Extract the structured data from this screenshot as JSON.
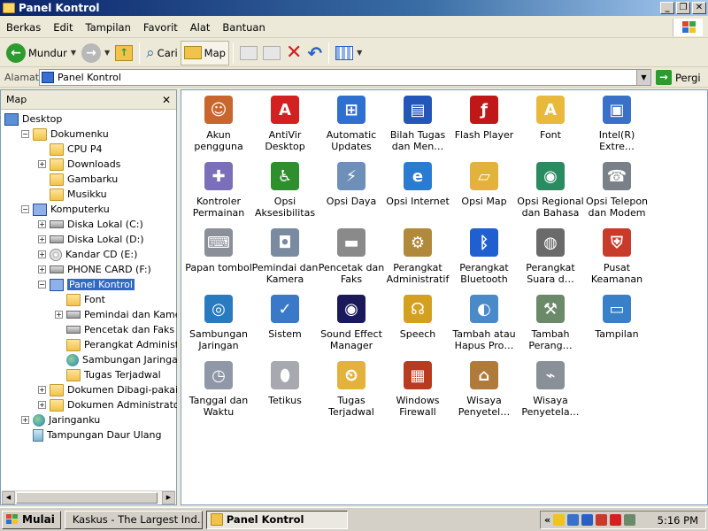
{
  "window": {
    "title": "Panel Kontrol"
  },
  "menu": [
    "Berkas",
    "Edit",
    "Tampilan",
    "Favorit",
    "Alat",
    "Bantuan"
  ],
  "toolbar": {
    "back_label": "Mundur",
    "search_label": "Cari",
    "folders_label": "Map"
  },
  "address": {
    "label": "Alamat",
    "value": "Panel Kontrol",
    "go_label": "Pergi"
  },
  "folders_pane": {
    "title": "Map",
    "tree": [
      {
        "label": "Desktop",
        "icon": "desktop-icon",
        "expander": ""
      },
      {
        "label": "Dokumenku",
        "icon": "folder-icon",
        "expander": "−"
      },
      {
        "label": "CPU P4",
        "icon": "folder-icon",
        "expander": ""
      },
      {
        "label": "Downloads",
        "icon": "folder-icon",
        "expander": "+"
      },
      {
        "label": "Gambarku",
        "icon": "folder-icon",
        "expander": ""
      },
      {
        "label": "Musikku",
        "icon": "folder-icon",
        "expander": ""
      },
      {
        "label": "Komputerku",
        "icon": "computer-icon",
        "expander": "−"
      },
      {
        "label": "Diska Lokal (C:)",
        "icon": "drive-icon",
        "expander": "+"
      },
      {
        "label": "Diska Lokal (D:)",
        "icon": "drive-icon",
        "expander": "+"
      },
      {
        "label": "Kandar CD (E:)",
        "icon": "cd-drive-icon",
        "expander": "+"
      },
      {
        "label": "PHONE CARD (F:)",
        "icon": "drive-icon",
        "expander": "+"
      },
      {
        "label": "Panel Kontrol",
        "icon": "control-panel-icon",
        "expander": "−",
        "selected": true
      },
      {
        "label": "Font",
        "icon": "folder-icon",
        "expander": ""
      },
      {
        "label": "Pemindai dan Kamera",
        "icon": "scanner-icon",
        "expander": "+"
      },
      {
        "label": "Pencetak dan Faks",
        "icon": "printer-icon",
        "expander": ""
      },
      {
        "label": "Perangkat Administratif",
        "icon": "admin-tools-icon",
        "expander": ""
      },
      {
        "label": "Sambungan Jaringan",
        "icon": "network-icon",
        "expander": ""
      },
      {
        "label": "Tugas Terjadwal",
        "icon": "folder-icon",
        "expander": ""
      },
      {
        "label": "Dokumen Dibagi-pakai",
        "icon": "folder-icon",
        "expander": "+"
      },
      {
        "label": "Dokumen Administrator",
        "icon": "folder-icon",
        "expander": "+"
      },
      {
        "label": "Jaringanku",
        "icon": "network-places-icon",
        "expander": "+"
      },
      {
        "label": "Tampungan Daur Ulang",
        "icon": "recycle-bin-icon",
        "expander": ""
      }
    ]
  },
  "items": [
    {
      "label": "Akun pengguna",
      "icon": "user-accounts-icon",
      "color": "#c9662e",
      "glyph": "☺"
    },
    {
      "label": "AntiVir Desktop",
      "icon": "antivir-icon",
      "color": "#d32020",
      "glyph": "A"
    },
    {
      "label": "Automatic Updates",
      "icon": "windows-update-icon",
      "color": "#2f6fd0",
      "glyph": "⊞"
    },
    {
      "label": "Bilah Tugas dan Men…",
      "icon": "taskbar-icon",
      "color": "#2356b8",
      "glyph": "▤"
    },
    {
      "label": "Flash Player",
      "icon": "flash-player-icon",
      "color": "#c01818",
      "glyph": "ƒ"
    },
    {
      "label": "Font",
      "icon": "font-folder-icon",
      "color": "#e9b93c",
      "glyph": "A"
    },
    {
      "label": "Intel(R) Extre…",
      "icon": "intel-graphics-icon",
      "color": "#3a70c8",
      "glyph": "▣"
    },
    {
      "label": "Kontroler Permainan",
      "icon": "game-controller-icon",
      "color": "#7a6fb8",
      "glyph": "✚"
    },
    {
      "label": "Opsi Aksesibilitas",
      "icon": "accessibility-icon",
      "color": "#2f8f2f",
      "glyph": "♿"
    },
    {
      "label": "Opsi Daya",
      "icon": "power-options-icon",
      "color": "#6e8fb8",
      "glyph": "⚡"
    },
    {
      "label": "Opsi Internet",
      "icon": "internet-options-icon",
      "color": "#2a7cd0",
      "glyph": "e"
    },
    {
      "label": "Opsi Map",
      "icon": "folder-options-icon",
      "color": "#e3b23c",
      "glyph": "▱"
    },
    {
      "label": "Opsi Regional dan Bahasa",
      "icon": "regional-globe-icon",
      "color": "#2a8a60",
      "glyph": "◉"
    },
    {
      "label": "Opsi Telepon dan Modem",
      "icon": "phone-modem-icon",
      "color": "#7a8088",
      "glyph": "☎"
    },
    {
      "label": "Papan tombol",
      "icon": "keyboard-icon",
      "color": "#8a8f98",
      "glyph": "⌨"
    },
    {
      "label": "Pemindai dan Kamera",
      "icon": "scanner-camera-icon",
      "color": "#7a8aa0",
      "glyph": "◘"
    },
    {
      "label": "Pencetak dan Faks",
      "icon": "printer-fax-icon",
      "color": "#8a8a8a",
      "glyph": "▬"
    },
    {
      "label": "Perangkat Administratif",
      "icon": "admin-tools-icon",
      "color": "#b08a3a",
      "glyph": "⚙"
    },
    {
      "label": "Perangkat Bluetooth",
      "icon": "bluetooth-icon",
      "color": "#1f5fd0",
      "glyph": "ᛒ"
    },
    {
      "label": "Perangkat Suara d…",
      "icon": "speaker-icon",
      "color": "#6a6a6a",
      "glyph": "◍"
    },
    {
      "label": "Pusat Keamanan",
      "icon": "security-shield-icon",
      "color": "#c83a2a",
      "glyph": "⛨"
    },
    {
      "label": "Sambungan Jaringan",
      "icon": "network-connections-icon",
      "color": "#2a7ac0",
      "glyph": "◎"
    },
    {
      "label": "Sistem",
      "icon": "system-icon",
      "color": "#3a78c8",
      "glyph": "✓"
    },
    {
      "label": "Sound Effect Manager",
      "icon": "sound-effect-icon",
      "color": "#1a1a5a",
      "glyph": "◉"
    },
    {
      "label": "Speech",
      "icon": "speech-icon",
      "color": "#d4a020",
      "glyph": "☊"
    },
    {
      "label": "Tambah atau Hapus Pro…",
      "icon": "add-remove-programs-icon",
      "color": "#4a8ac8",
      "glyph": "◐"
    },
    {
      "label": "Tambah Perang…",
      "icon": "add-hardware-icon",
      "color": "#6a8a6a",
      "glyph": "⚒"
    },
    {
      "label": "Tampilan",
      "icon": "display-icon",
      "color": "#3a80c8",
      "glyph": "▭"
    },
    {
      "label": "Tanggal dan Waktu",
      "icon": "date-time-icon",
      "color": "#9098a8",
      "glyph": "◷"
    },
    {
      "label": "Tetikus",
      "icon": "mouse-icon",
      "color": "#a8a8b0",
      "glyph": "⬮"
    },
    {
      "label": "Tugas Terjadwal",
      "icon": "scheduled-tasks-icon",
      "color": "#e3b23c",
      "glyph": "⏲"
    },
    {
      "label": "Windows Firewall",
      "icon": "firewall-icon",
      "color": "#b83a20",
      "glyph": "▦"
    },
    {
      "label": "Wisaya Penyetel…",
      "icon": "network-setup-wizard-icon",
      "color": "#b07a3a",
      "glyph": "⌂"
    },
    {
      "label": "Wisaya Penyetela…",
      "icon": "wireless-setup-wizard-icon",
      "color": "#8a9098",
      "glyph": "⌁"
    }
  ],
  "taskbar": {
    "start_label": "Mulai",
    "tasks": [
      {
        "label": "Kaskus - The Largest Ind…",
        "active": false
      },
      {
        "label": "Panel Kontrol",
        "active": true
      }
    ],
    "tray_chevron": "«",
    "clock": "5:16 PM"
  }
}
